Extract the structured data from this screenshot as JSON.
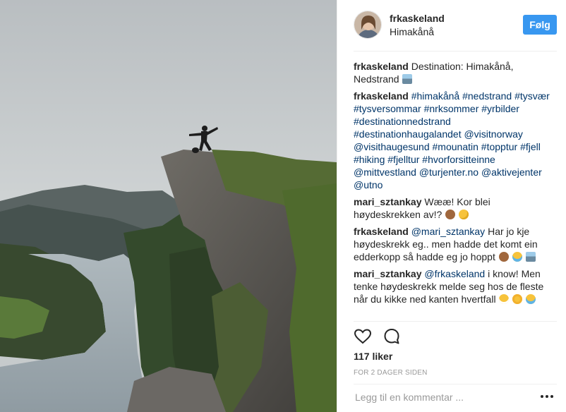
{
  "post": {
    "username": "frkaskeland",
    "location": "Himakånå",
    "follow_label": "Følg"
  },
  "caption": {
    "user": "frkaskeland",
    "text": "Destination: Himakånå, Nedstrand",
    "emoji": "mountain-emoji"
  },
  "hashtag_comment": {
    "user": "frkaskeland",
    "tags": [
      "#himakånå",
      "#nedstrand",
      "#tysvær",
      "#tysversommar",
      "#nrksommer",
      "#yrbilder",
      "#destinationnedstrand",
      "#destinationhaugalandet",
      "@visitnorway",
      "@visithaugesund",
      "#mounatin",
      "#topptur",
      "#fjell",
      "#hiking",
      "#fjelltur",
      "#hvorforsitteinne",
      "@mittvestland",
      "@turjenter.no",
      "@aktivejenter",
      "@utno"
    ]
  },
  "comments": [
    {
      "user": "mari_sztankay",
      "text": "Wææ! Kor blei høydeskrekken av!?"
    },
    {
      "user": "frkaskeland",
      "mention": "@mari_sztankay",
      "text": "Har jo kje høydeskrekk eg.. men hadde det komt ein edderkopp så hadde eg jo hoppt"
    },
    {
      "user": "mari_sztankay",
      "mention": "@frkaskeland",
      "text": "i know! Men tenke høydeskrekk melde seg hos de fleste når du kikke ned kanten hvertfall"
    }
  ],
  "actions": {
    "likes": "117 liker",
    "time_ago": "FOR 2 DAGER SIDEN",
    "comment_placeholder": "Legg til en kommentar ..."
  },
  "colors": {
    "follow_button": "#3897f0",
    "link": "#003569",
    "divider": "#efefef"
  }
}
